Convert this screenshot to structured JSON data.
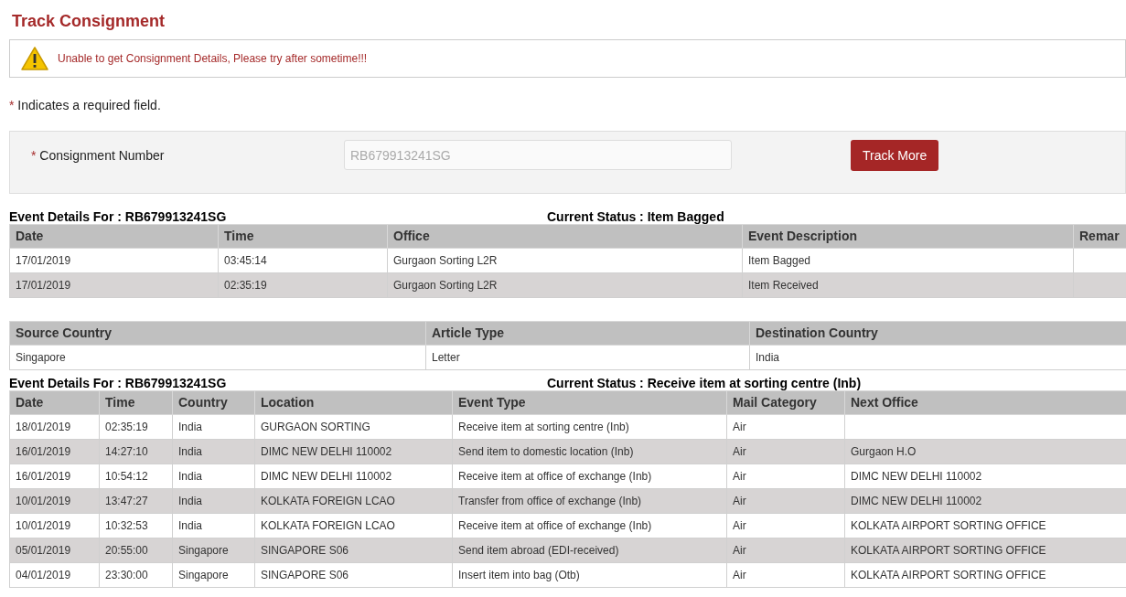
{
  "page_title": "Track Consignment",
  "alert": {
    "message": "Unable to get Consignment Details, Please try after sometime!!!"
  },
  "required_note": {
    "mark": "*",
    "text": "Indicates a required field."
  },
  "form": {
    "label_mark": "*",
    "label": "Consignment Number",
    "placeholder": "RB679913241SG",
    "button": "Track More"
  },
  "events_summary": {
    "left": "Event Details For : RB679913241SG",
    "right": "Current Status : Item Bagged"
  },
  "events_table": {
    "columns": [
      "Date",
      "Time",
      "Office",
      "Event Description",
      "Remar"
    ],
    "rows": [
      [
        "17/01/2019",
        "03:45:14",
        "Gurgaon Sorting L2R",
        "Item Bagged",
        ""
      ],
      [
        "17/01/2019",
        "02:35:19",
        "Gurgaon Sorting L2R",
        "Item Received",
        ""
      ]
    ]
  },
  "article_table": {
    "columns": [
      "Source Country",
      "Article Type",
      "Destination Country"
    ],
    "rows": [
      [
        "Singapore",
        "Letter",
        "India"
      ]
    ]
  },
  "tracking_summary": {
    "left": "Event Details For : RB679913241SG",
    "right": "Current Status : Receive item at sorting centre (Inb)"
  },
  "tracking_table": {
    "columns": [
      "Date",
      "Time",
      "Country",
      "Location",
      "Event Type",
      "Mail Category",
      "Next Office"
    ],
    "rows": [
      [
        "18/01/2019",
        "02:35:19",
        "India",
        "GURGAON SORTING",
        "Receive item at sorting centre (Inb)",
        "Air",
        ""
      ],
      [
        "16/01/2019",
        "14:27:10",
        "India",
        "DIMC NEW DELHI 110002",
        "Send item to domestic location (Inb)",
        "Air",
        "Gurgaon H.O"
      ],
      [
        "16/01/2019",
        "10:54:12",
        "India",
        "DIMC NEW DELHI 110002",
        "Receive item at office of exchange (Inb)",
        "Air",
        "DIMC NEW DELHI 110002"
      ],
      [
        "10/01/2019",
        "13:47:27",
        "India",
        "KOLKATA FOREIGN LCAO",
        "Transfer from office of exchange (Inb)",
        "Air",
        "DIMC NEW DELHI 110002"
      ],
      [
        "10/01/2019",
        "10:32:53",
        "India",
        "KOLKATA FOREIGN LCAO",
        "Receive item at office of exchange (Inb)",
        "Air",
        "KOLKATA AIRPORT SORTING OFFICE"
      ],
      [
        "05/01/2019",
        "20:55:00",
        "Singapore",
        "SINGAPORE S06",
        "Send item abroad (EDI-received)",
        "Air",
        "KOLKATA AIRPORT SORTING OFFICE"
      ],
      [
        "04/01/2019",
        "23:30:00",
        "Singapore",
        "SINGAPORE S06",
        "Insert item into bag (Otb)",
        "Air",
        "KOLKATA AIRPORT SORTING OFFICE"
      ]
    ]
  }
}
